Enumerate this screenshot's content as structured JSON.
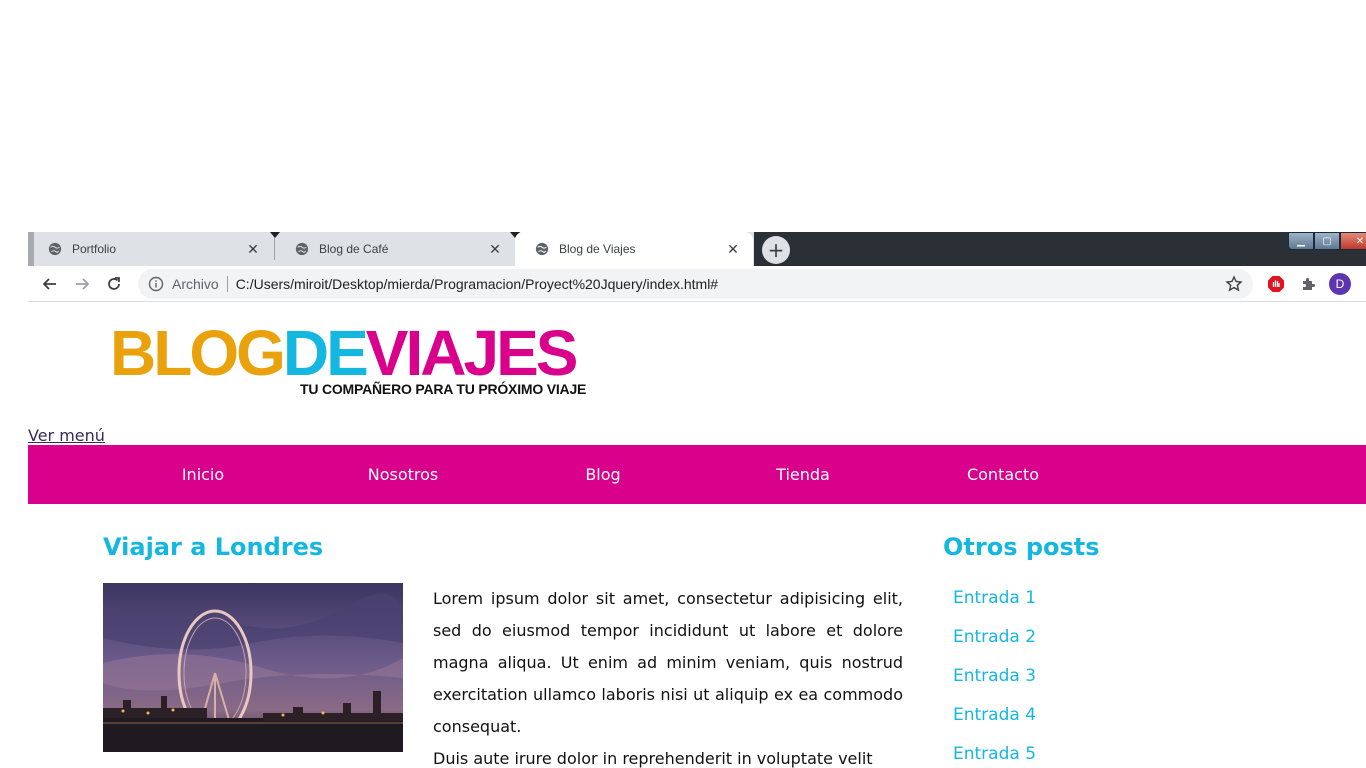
{
  "browser": {
    "tabs": [
      {
        "title": "Portfolio",
        "close": "✕"
      },
      {
        "title": "Blog de Café",
        "close": "✕"
      },
      {
        "title": "Blog de Viajes",
        "close": "✕"
      }
    ],
    "new_tab": "+",
    "address": {
      "scheme_label": "Archivo",
      "url": "C:/Users/miroit/Desktop/mierda/Programacion/Proyect%20Jquery/index.html#"
    },
    "profile_initial": "D"
  },
  "header": {
    "logo": {
      "part_blog": "BLOG",
      "part_de": "DE",
      "part_viajes": "VIAJES",
      "tagline": "TU COMPAÑERO PARA TU PRÓXIMO VIAJE"
    },
    "menu_toggle": "Ver menú"
  },
  "nav": {
    "items": [
      {
        "label": "Inicio"
      },
      {
        "label": "Nosotros"
      },
      {
        "label": "Blog"
      },
      {
        "label": "Tienda"
      },
      {
        "label": "Contacto"
      }
    ]
  },
  "main": {
    "title": "Viajar a Londres",
    "paragraphs": [
      "Lorem ipsum dolor sit amet, consectetur adipisicing elit, sed do eiusmod tempor incididunt ut labore et dolore magna aliqua. Ut enim ad minim veniam, quis nostrud exercitation ullamco laboris nisi ut aliquip ex ea commodo consequat.",
      "Duis aute irure dolor in reprehenderit in voluptate velit"
    ]
  },
  "sidebar": {
    "title": "Otros posts",
    "entries": [
      {
        "label": "Entrada 1"
      },
      {
        "label": "Entrada 2"
      },
      {
        "label": "Entrada 3"
      },
      {
        "label": "Entrada 4"
      },
      {
        "label": "Entrada 5"
      }
    ]
  },
  "colors": {
    "brand_pink": "#d9008b",
    "brand_blue": "#14b7e0",
    "brand_orange": "#eaa20c"
  }
}
